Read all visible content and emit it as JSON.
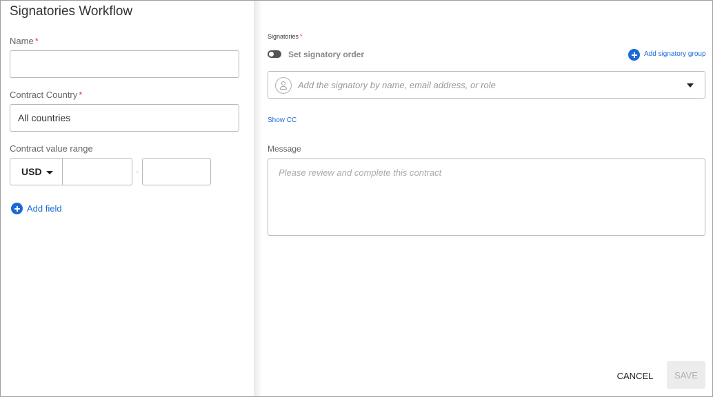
{
  "left": {
    "title": "Signatories Workflow",
    "name": {
      "label": "Name",
      "required_mark": "*",
      "value": ""
    },
    "country": {
      "label": "Contract Country",
      "required_mark": "*",
      "value": "All countries"
    },
    "range": {
      "label": "Contract value range",
      "currency": "USD",
      "min": "",
      "separator": "-",
      "max": ""
    },
    "add_field": {
      "label": "Add field",
      "icon": "plus-circle-icon"
    }
  },
  "right": {
    "signatories": {
      "label": "Signatories",
      "required_mark": "*"
    },
    "order_toggle": {
      "label": "Set signatory order",
      "on": false
    },
    "add_group": {
      "label": "Add signatory group",
      "icon": "plus-circle-icon"
    },
    "signatory_input": {
      "placeholder": "Add the signatory by name, email address, or role",
      "icon": "person-icon"
    },
    "show_cc": "Show CC",
    "message": {
      "label": "Message",
      "placeholder": "Please review and complete this contract"
    }
  },
  "footer": {
    "cancel_label": "CANCEL",
    "save_label": "SAVE"
  },
  "colors": {
    "accent": "#1a6ad4",
    "required": "#e53935",
    "disabled_bg": "#ececec"
  }
}
